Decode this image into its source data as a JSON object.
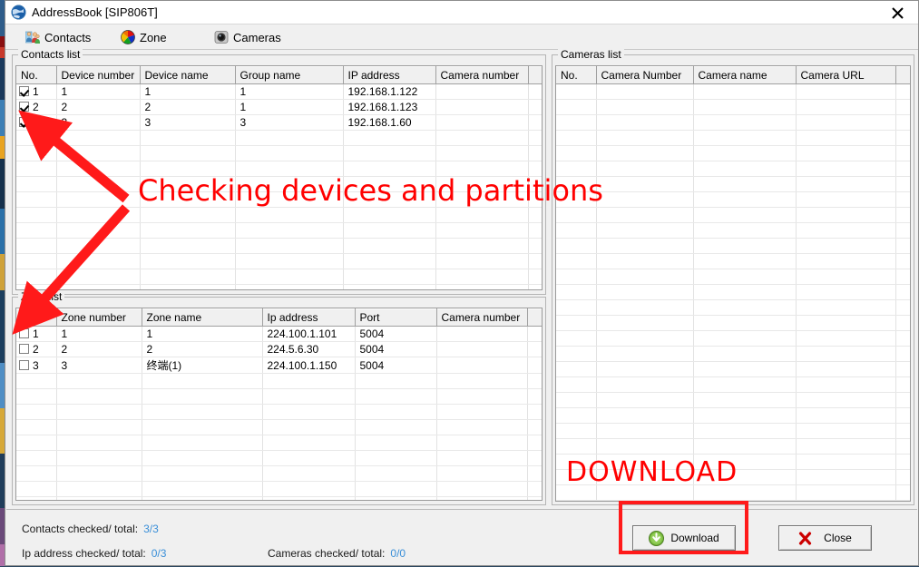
{
  "window": {
    "title": "AddressBook [SIP806T]",
    "icon": "globe-icon",
    "close_label": "✕"
  },
  "toolbar": {
    "items": [
      {
        "label": "Contacts",
        "icon": "contacts-icon"
      },
      {
        "label": "Zone",
        "icon": "zone-color-wheel-icon"
      },
      {
        "label": "Cameras",
        "icon": "camera-icon"
      }
    ]
  },
  "contacts_panel": {
    "title": "Contacts list",
    "columns": [
      "No.",
      "Device number",
      "Device name",
      "Group name",
      "IP address",
      "Camera number",
      ""
    ],
    "rows": [
      {
        "checked": true,
        "no": "1",
        "device_number": "1",
        "device_name": "1",
        "group_name": "1",
        "ip_address": "192.168.1.122",
        "camera_number": ""
      },
      {
        "checked": true,
        "no": "2",
        "device_number": "2",
        "device_name": "2",
        "group_name": "1",
        "ip_address": "192.168.1.123",
        "camera_number": ""
      },
      {
        "checked": true,
        "no": "3",
        "device_number": "3",
        "device_name": "3",
        "group_name": "3",
        "ip_address": "192.168.1.60",
        "camera_number": ""
      }
    ],
    "empty_rows": 11
  },
  "zone_panel": {
    "title": "Zone list",
    "columns": [
      "No.",
      "Zone number",
      "Zone name",
      "Ip address",
      "Port",
      "Camera number",
      ""
    ],
    "rows": [
      {
        "checked": false,
        "no": "1",
        "zone_number": "1",
        "zone_name": "1",
        "ip_address": "224.100.1.101",
        "port": "5004",
        "camera_number": ""
      },
      {
        "checked": false,
        "no": "2",
        "zone_number": "2",
        "zone_name": "2",
        "ip_address": "224.5.6.30",
        "port": "5004",
        "camera_number": ""
      },
      {
        "checked": false,
        "no": "3",
        "zone_number": "3",
        "zone_name": "终端(1)",
        "ip_address": "224.100.1.150",
        "port": "5004",
        "camera_number": ""
      }
    ],
    "empty_rows": 9
  },
  "cameras_panel": {
    "title": "Cameras list",
    "columns": [
      "No.",
      "Camera Number",
      "Camera name",
      "Camera URL",
      ""
    ],
    "rows": [],
    "empty_rows": 28
  },
  "status": {
    "contacts_label": "Contacts checked/ total:",
    "contacts_value": "3/3",
    "ip_label": "Ip address checked/ total:",
    "ip_value": "0/3",
    "cameras_label": "Cameras checked/ total:",
    "cameras_value": "0/0"
  },
  "buttons": {
    "download": "Download",
    "close": "Close"
  },
  "annotations": {
    "checking_text": "Checking devices and partitions",
    "download_text": "DOWNLOAD",
    "color": "#ff0000"
  }
}
